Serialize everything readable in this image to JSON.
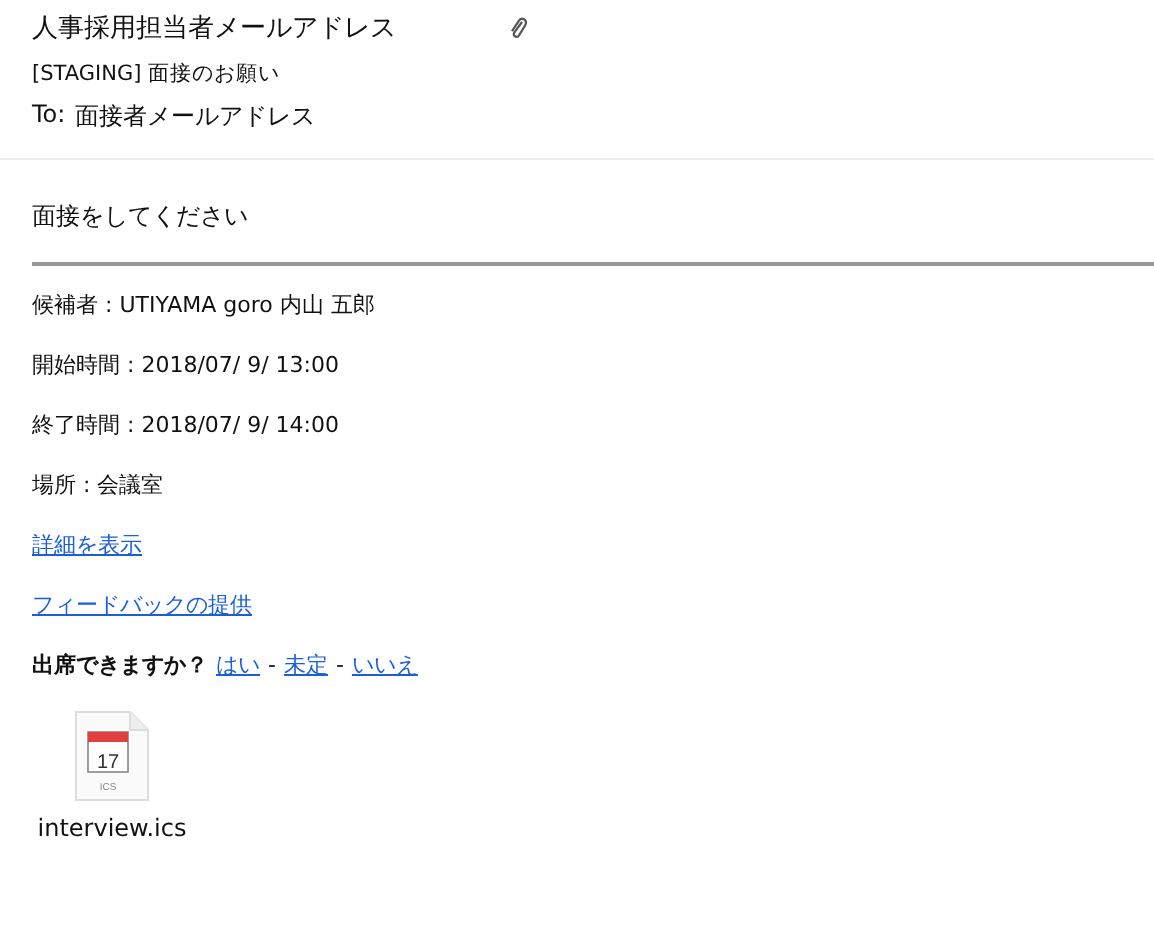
{
  "header": {
    "sender": "人事採用担当者メールアドレス",
    "subject": "[STAGING] 面接のお願い",
    "to_label": "To:",
    "to": "面接者メールアドレス"
  },
  "body": {
    "intro": "面接をしてください",
    "fields": [
      "候補者 : UTIYAMA goro 内山 五郎",
      "開始時間 : 2018/07/ 9/ 13:00",
      "終了時間 : 2018/07/ 9/ 14:00",
      "場所 : 会議室"
    ],
    "links": [
      "詳細を表示",
      "フィードバックの提供"
    ],
    "rsvp": {
      "question": "出席できますか？",
      "options": [
        "はい",
        "未定",
        "いいえ"
      ],
      "separator": "-"
    }
  },
  "attachment": {
    "filename": "interview.ics",
    "icon_day": "17",
    "icon_type": "ICS"
  }
}
